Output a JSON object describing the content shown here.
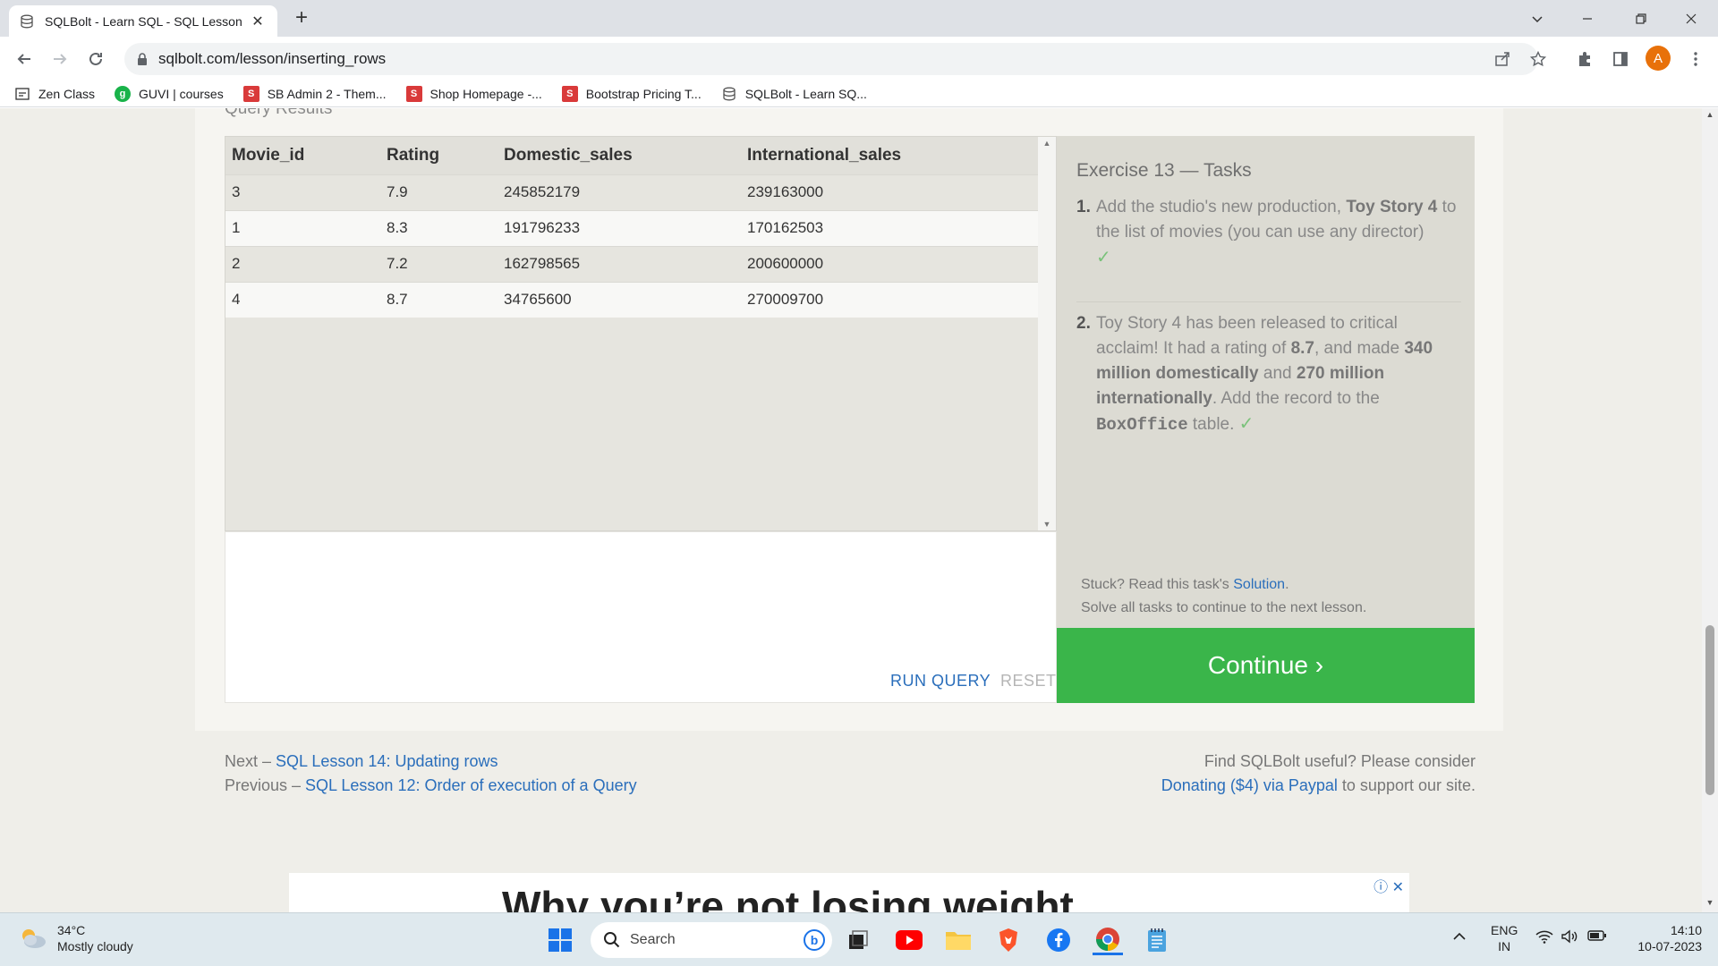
{
  "browser": {
    "tab_title": "SQLBolt - Learn SQL - SQL Lesson",
    "url": "sqlbolt.com/lesson/inserting_rows",
    "avatar_letter": "A",
    "bookmarks": [
      {
        "label": "Zen Class",
        "icon": "zen-icon"
      },
      {
        "label": "GUVI | courses",
        "icon": "guvi-icon"
      },
      {
        "label": "SB Admin 2 - Them...",
        "icon": "s-icon"
      },
      {
        "label": "Shop Homepage -...",
        "icon": "s-icon"
      },
      {
        "label": "Bootstrap Pricing T...",
        "icon": "s-icon"
      },
      {
        "label": "SQLBolt - Learn SQ...",
        "icon": "database-icon"
      }
    ]
  },
  "results": {
    "section_header": "Query Results",
    "columns": [
      "Movie_id",
      "Rating",
      "Domestic_sales",
      "International_sales"
    ],
    "rows": [
      [
        "3",
        "7.9",
        "245852179",
        "239163000"
      ],
      [
        "1",
        "8.3",
        "191796233",
        "170162503"
      ],
      [
        "2",
        "7.2",
        "162798565",
        "200600000"
      ],
      [
        "4",
        "8.7",
        "34765600",
        "270009700"
      ]
    ]
  },
  "editor": {
    "run_label": "RUN QUERY",
    "reset_label": "RESET"
  },
  "tasks": {
    "title": "Exercise 13 — Tasks",
    "task1_num": "1.",
    "task1_a": "Add the studio's new production, ",
    "task1_b": "Toy Story 4",
    "task1_c": " to the list of movies (you can use any director)",
    "task2_num": "2.",
    "task2_a": "Toy Story 4 has been released to critical acclaim! It had a rating of ",
    "task2_b": "8.7",
    "task2_c": ", and made ",
    "task2_d": "340 million domestically",
    "task2_e": " and ",
    "task2_f": "270 million internationally",
    "task2_g": ". Add the record to the ",
    "task2_code": "BoxOffice",
    "task2_h": " table.",
    "check": "✓",
    "stuck_prefix": "Stuck? Read this task's ",
    "solution_link": "Solution",
    "stuck_suffix": ".",
    "solve_all": "Solve all tasks to continue to the next lesson.",
    "continue_label": "Continue ›"
  },
  "footer": {
    "next_prefix": "Next – ",
    "next_link": "SQL Lesson 14: Updating rows",
    "prev_prefix": "Previous – ",
    "prev_link": "SQL Lesson 12: Order of execution of a Query",
    "useful_text": "Find SQLBolt useful? Please consider",
    "donate_link": "Donating ($4) via Paypal",
    "donate_suffix": " to support our site."
  },
  "ad": {
    "text": "Why you’re not losing weight"
  },
  "taskbar": {
    "temperature": "34°C",
    "weather": "Mostly cloudy",
    "search_placeholder": "Search",
    "lang_top": "ENG",
    "lang_bottom": "IN",
    "time": "14:10",
    "date": "10-07-2023"
  },
  "colors": {
    "continue_green": "#3ab54a",
    "link_blue": "#2a6ebb",
    "check_green": "#7ac27a"
  }
}
